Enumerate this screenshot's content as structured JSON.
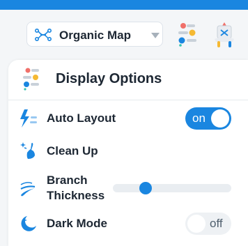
{
  "toolbar": {
    "map_select_value": "Organic Map"
  },
  "panel": {
    "title": "Display Options",
    "rows": [
      {
        "label": "Auto Layout",
        "control": "toggle",
        "value": "on"
      },
      {
        "label": "Clean Up",
        "control": "action"
      },
      {
        "label_line1": "Branch",
        "label_line2": "Thickness",
        "control": "slider",
        "value": 0.25
      },
      {
        "label": "Dark Mode",
        "control": "toggle",
        "value": "off"
      }
    ]
  },
  "colors": {
    "accent": "#1a86e0",
    "top_bar": "#1a86e0",
    "dot_red": "#f0706a",
    "dot_yellow": "#f5b933",
    "dot_blue": "#1a86e0",
    "dot_teal": "#35c3b0"
  },
  "icons": {
    "map_select": "mindmap-icon",
    "display": "display-options-icon",
    "fancy": "fancy-icon",
    "auto_layout": "lightning-icon",
    "clean_up": "broom-icon",
    "branch_thickness": "brush-icon",
    "dark_mode": "moon-icon"
  }
}
